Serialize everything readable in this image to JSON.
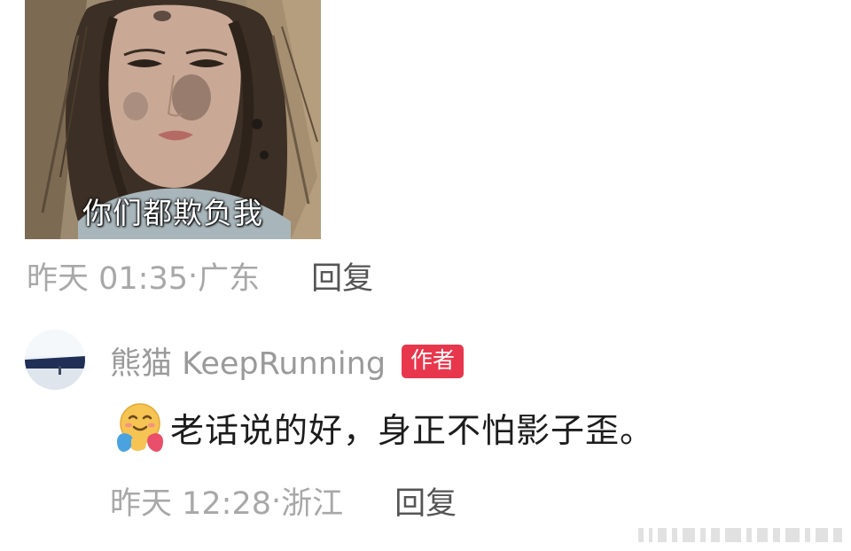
{
  "post_image": {
    "caption": "你们都欺负我"
  },
  "post_meta": {
    "time": "昨天 01:35",
    "separator": "· ",
    "location": "广东",
    "reply_label": "回复"
  },
  "comment": {
    "username": "熊猫 KeepRunning",
    "author_badge": "作者",
    "emoji": "hugging-face-icon",
    "text": "老话说的好，身正不怕影子歪。",
    "time": "昨天 12:28",
    "separator": "· ",
    "location": "浙江",
    "reply_label": "回复"
  },
  "colors": {
    "author_badge": "#e8374d",
    "meta_text": "#a8a8a8",
    "reply_text": "#555555",
    "comment_text": "#1c1c1c"
  }
}
